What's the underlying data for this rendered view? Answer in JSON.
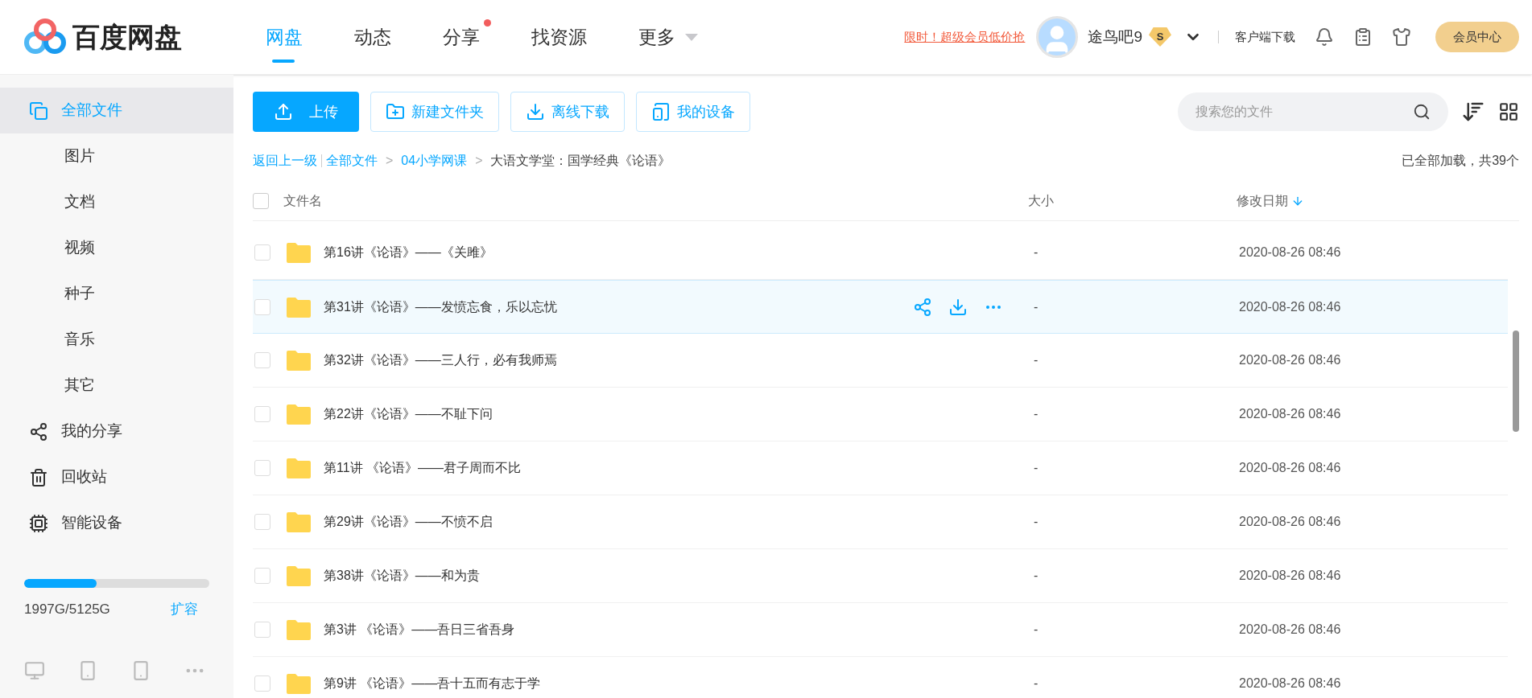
{
  "header": {
    "logo": "百度网盘",
    "nav": [
      {
        "label": "网盘",
        "selected": true,
        "dot": false,
        "kind": "link"
      },
      {
        "label": "动态",
        "selected": false,
        "dot": false,
        "kind": "link"
      },
      {
        "label": "分享",
        "selected": false,
        "dot": true,
        "kind": "link"
      },
      {
        "label": "找资源",
        "selected": false,
        "dot": false,
        "kind": "link"
      },
      {
        "label": "更多",
        "selected": false,
        "dot": false,
        "kind": "dropdown"
      }
    ],
    "promo": "限时！超级会员低价抢",
    "user": "途鸟吧9",
    "vip_badge": "S",
    "client_download": "客户端下载",
    "member_center": "会员中心"
  },
  "sidebar": {
    "items": [
      {
        "label": "全部文件",
        "kind": "icon",
        "selected": true
      },
      {
        "label": "图片",
        "kind": "sub",
        "selected": false
      },
      {
        "label": "文档",
        "kind": "sub",
        "selected": false
      },
      {
        "label": "视频",
        "kind": "sub",
        "selected": false
      },
      {
        "label": "种子",
        "kind": "sub",
        "selected": false
      },
      {
        "label": "音乐",
        "kind": "sub",
        "selected": false
      },
      {
        "label": "其它",
        "kind": "sub",
        "selected": false
      },
      {
        "label": "我的分享",
        "kind": "icon",
        "selected": false
      },
      {
        "label": "回收站",
        "kind": "icon",
        "selected": false
      },
      {
        "label": "智能设备",
        "kind": "icon",
        "selected": false
      }
    ],
    "storage": {
      "level": 0.39,
      "reading": "1997G/5125G",
      "expand": "扩容"
    }
  },
  "toolbar": {
    "buttons": [
      {
        "label": "上传",
        "kind": "primary"
      },
      {
        "label": "新建文件夹",
        "kind": "outline"
      },
      {
        "label": "离线下载",
        "kind": "outline"
      },
      {
        "label": "我的设备",
        "kind": "outline"
      }
    ],
    "search": {
      "placeholder": "搜索您的文件"
    }
  },
  "breadcrumb": {
    "back": "返回上一级",
    "items": [
      {
        "label": "全部文件",
        "kind": "link"
      },
      {
        "label": "04小学网课",
        "kind": "link"
      },
      {
        "label": "大语文学堂：国学经典《论语》",
        "kind": "current"
      }
    ],
    "separator": ">",
    "status": "已全部加载，共39个"
  },
  "table": {
    "all_checked": false,
    "columns": [
      "文件名",
      "大小",
      "修改日期"
    ],
    "rows": [
      {
        "name": "第16讲《论语》——《关雎》",
        "size": "-",
        "date": "2020-08-26 08:46",
        "highlighted": false,
        "checked": false
      },
      {
        "name": "第31讲《论语》——发愤忘食，乐以忘忧",
        "size": "-",
        "date": "2020-08-26 08:46",
        "highlighted": true,
        "checked": false
      },
      {
        "name": "第32讲《论语》——三人行，必有我师焉",
        "size": "-",
        "date": "2020-08-26 08:46",
        "highlighted": false,
        "checked": false
      },
      {
        "name": "第22讲《论语》——不耻下问",
        "size": "-",
        "date": "2020-08-26 08:46",
        "highlighted": false,
        "checked": false
      },
      {
        "name": "第11讲 《论语》——君子周而不比",
        "size": "-",
        "date": "2020-08-26 08:46",
        "highlighted": false,
        "checked": false
      },
      {
        "name": "第29讲《论语》——不愤不启",
        "size": "-",
        "date": "2020-08-26 08:46",
        "highlighted": false,
        "checked": false
      },
      {
        "name": "第38讲《论语》——和为贵",
        "size": "-",
        "date": "2020-08-26 08:46",
        "highlighted": false,
        "checked": false
      },
      {
        "name": "第3讲 《论语》——吾日三省吾身",
        "size": "-",
        "date": "2020-08-26 08:46",
        "highlighted": false,
        "checked": false
      },
      {
        "name": "第9讲 《论语》——吾十五而有志于学",
        "size": "-",
        "date": "2020-08-26 08:46",
        "highlighted": false,
        "checked": false
      }
    ]
  }
}
